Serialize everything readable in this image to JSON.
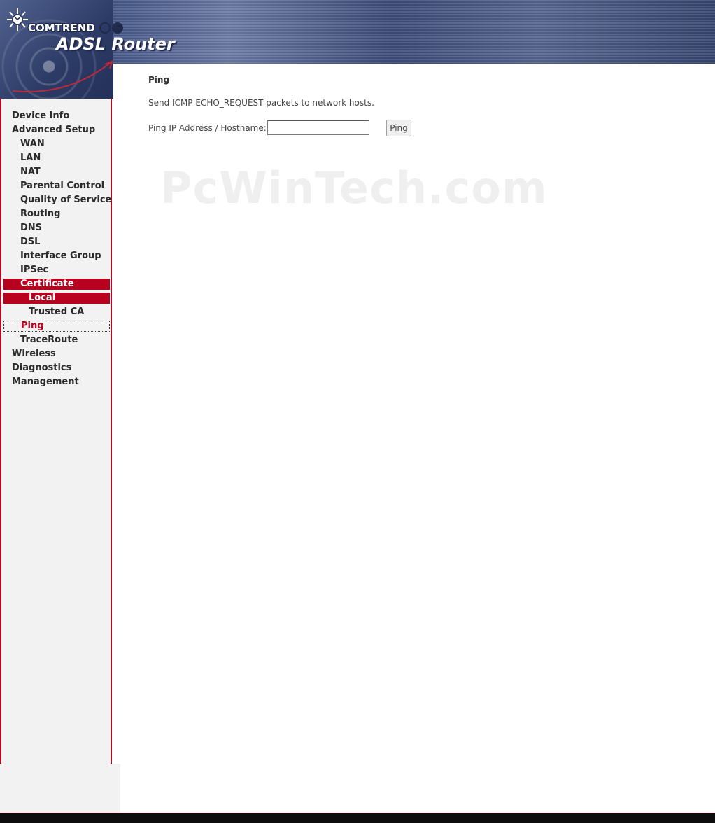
{
  "header": {
    "brand": "COMTREND",
    "product": "ADSL Router"
  },
  "watermark": "PcWinTech.com",
  "sidebar": {
    "items": [
      {
        "label": "Device Info",
        "level": 0
      },
      {
        "label": "Advanced Setup",
        "level": 0
      },
      {
        "label": "WAN",
        "level": 1
      },
      {
        "label": "LAN",
        "level": 1
      },
      {
        "label": "NAT",
        "level": 1
      },
      {
        "label": "Parental Control",
        "level": 1
      },
      {
        "label": "Quality of Service",
        "level": 1
      },
      {
        "label": "Routing",
        "level": 1
      },
      {
        "label": "DNS",
        "level": 1
      },
      {
        "label": "DSL",
        "level": 1
      },
      {
        "label": "Interface Group",
        "level": 1
      },
      {
        "label": "IPSec",
        "level": 1
      },
      {
        "label": "Certificate",
        "level": 1,
        "state": "selected"
      },
      {
        "label": "Local",
        "level": 2,
        "state": "selected"
      },
      {
        "label": "Trusted CA",
        "level": 2
      },
      {
        "label": "Ping",
        "level": 1,
        "state": "current"
      },
      {
        "label": "TraceRoute",
        "level": 1
      },
      {
        "label": "Wireless",
        "level": 0
      },
      {
        "label": "Diagnostics",
        "level": 0
      },
      {
        "label": "Management",
        "level": 0
      }
    ]
  },
  "main": {
    "title": "Ping",
    "description": "Send ICMP ECHO_REQUEST packets to network hosts.",
    "field_label": "Ping IP Address / Hostname:",
    "field_value": "",
    "button_label": "Ping"
  },
  "colors": {
    "accent": "#b8001f",
    "current_text": "#c1001f",
    "sidebar_bg": "#f2f2f2",
    "banner": "#3c4b78"
  }
}
